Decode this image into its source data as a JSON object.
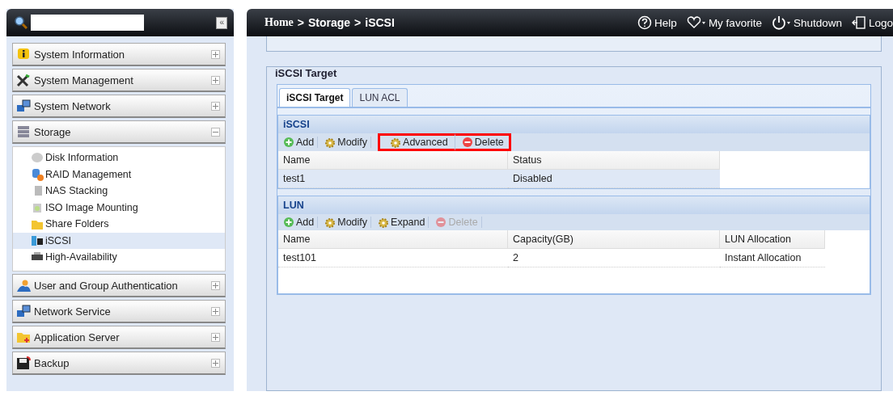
{
  "sidebar": {
    "collapse_button": "«",
    "groups": [
      {
        "label": "System Information",
        "expanded": false
      },
      {
        "label": "System Management",
        "expanded": false
      },
      {
        "label": "System Network",
        "expanded": false
      },
      {
        "label": "Storage",
        "expanded": true,
        "children": [
          {
            "label": "Disk Information",
            "selected": false
          },
          {
            "label": "RAID Management",
            "selected": false
          },
          {
            "label": "NAS Stacking",
            "selected": false
          },
          {
            "label": "ISO Image Mounting",
            "selected": false
          },
          {
            "label": "Share Folders",
            "selected": false
          },
          {
            "label": "iSCSI",
            "selected": true
          },
          {
            "label": "High-Availability",
            "selected": false
          }
        ]
      },
      {
        "label": "User and Group Authentication",
        "expanded": false
      },
      {
        "label": "Network Service",
        "expanded": false
      },
      {
        "label": "Application Server",
        "expanded": false
      },
      {
        "label": "Backup",
        "expanded": false
      }
    ]
  },
  "header": {
    "breadcrumb": [
      {
        "label": "Home",
        "kind": "link"
      },
      {
        "label": ">",
        "kind": "sep"
      },
      {
        "label": "Storage",
        "kind": "link"
      },
      {
        "label": ">",
        "kind": "sep"
      },
      {
        "label": "iSCSI",
        "kind": "current"
      }
    ],
    "actions": [
      {
        "label": "Help",
        "kind": "help"
      },
      {
        "label": "My favorite",
        "kind": "favorite"
      },
      {
        "label": "Shutdown",
        "kind": "power"
      },
      {
        "label": "Logo",
        "kind": "logout"
      }
    ]
  },
  "fieldset": {
    "legend": "iSCSI Target",
    "tabs": [
      {
        "label": "iSCSI Target",
        "selected": true
      },
      {
        "label": "LUN ACL",
        "selected": false
      }
    ],
    "panels": [
      {
        "title": "iSCSI",
        "toolbar": [
          {
            "label": "Add",
            "kind": "add",
            "disabled": false,
            "highlighted": false
          },
          {
            "label": "Modify",
            "kind": "gear",
            "disabled": false,
            "highlighted": false
          },
          {
            "label": "Advanced",
            "kind": "gear",
            "disabled": false,
            "highlighted": true
          },
          {
            "label": "Delete",
            "kind": "delete",
            "disabled": false,
            "highlighted": true
          }
        ],
        "columns": [
          "Name",
          "Status"
        ],
        "rows": [
          {
            "cells": [
              "test1",
              "Disabled"
            ],
            "selected": true
          }
        ]
      },
      {
        "title": "LUN",
        "toolbar": [
          {
            "label": "Add",
            "kind": "add",
            "disabled": false,
            "highlighted": false
          },
          {
            "label": "Modify",
            "kind": "gear",
            "disabled": false,
            "highlighted": false
          },
          {
            "label": "Expand",
            "kind": "gear",
            "disabled": false,
            "highlighted": false
          },
          {
            "label": "Delete",
            "kind": "delete",
            "disabled": true,
            "highlighted": false
          }
        ],
        "columns": [
          "Name",
          "Capacity(GB)",
          "LUN Allocation"
        ],
        "rows": [
          {
            "cells": [
              "test101",
              "2",
              "Instant Allocation"
            ],
            "selected": false
          }
        ]
      }
    ]
  }
}
